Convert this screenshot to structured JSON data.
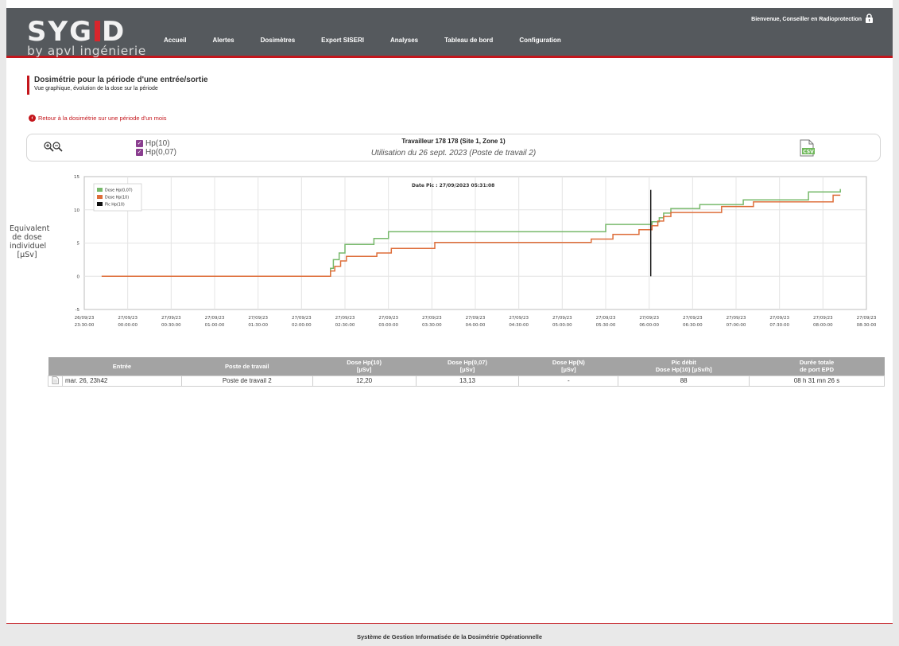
{
  "logo": {
    "main_left": "SYG",
    "main_right": "D",
    "sub": "by apvl ingénierie"
  },
  "nav": [
    "Accueil",
    "Alertes",
    "Dosimètres",
    "Export SISERI",
    "Analyses",
    "Tableau de bord",
    "Configuration"
  ],
  "welcome": "Bienvenue, Conseiller en Radioprotection",
  "page": {
    "title": "Dosimétrie pour la période d'une entrée/sortie",
    "subtitle": "Vue graphique, évolution de la dose sur la période",
    "back_link": "Retour à la dosimétrie sur une période d'un mois"
  },
  "info": {
    "checks": [
      "Hp(10)",
      "Hp(0,07)"
    ],
    "worker": "Travailleur 178 178 (Site 1, Zone 1)",
    "usage": "Utilisation du 26 sept. 2023 (Poste de travail 2)",
    "csv_label": "CSV"
  },
  "chart_data": {
    "type": "line",
    "ylabel": [
      "Equivalent",
      "de dose",
      "individuel",
      "[µSv]"
    ],
    "ylim": [
      -5,
      15
    ],
    "yticks": [
      -5,
      0,
      5,
      10,
      15
    ],
    "xlim_minutes": [
      -30,
      510
    ],
    "xticks": [
      [
        "26/09/23",
        "23:30:00"
      ],
      [
        "27/09/23",
        "00:00:00"
      ],
      [
        "27/09/23",
        "00:30:00"
      ],
      [
        "27/09/23",
        "01:00:00"
      ],
      [
        "27/09/23",
        "01:30:00"
      ],
      [
        "27/09/23",
        "02:00:00"
      ],
      [
        "27/09/23",
        "02:30:00"
      ],
      [
        "27/09/23",
        "03:00:00"
      ],
      [
        "27/09/23",
        "03:30:00"
      ],
      [
        "27/09/23",
        "04:00:00"
      ],
      [
        "27/09/23",
        "04:30:00"
      ],
      [
        "27/09/23",
        "05:00:00"
      ],
      [
        "27/09/23",
        "05:30:00"
      ],
      [
        "27/09/23",
        "06:00:00"
      ],
      [
        "27/09/23",
        "06:30:00"
      ],
      [
        "27/09/23",
        "07:00:00"
      ],
      [
        "27/09/23",
        "07:30:00"
      ],
      [
        "27/09/23",
        "08:00:00"
      ],
      [
        "27/09/23",
        "08:30:00"
      ]
    ],
    "annotation": "Date Pic : 27/09/2023 05:31:08",
    "legend": [
      "Dose Hp(0,07)",
      "Dose Hp(10)",
      "Pic Hp(10)"
    ],
    "legend_position": "top-left",
    "grid": true,
    "series": [
      {
        "name": "Dose Hp(0,07)",
        "color": "#77b96b",
        "x": [
          -18,
          140,
          140,
          142,
          142,
          146,
          146,
          150,
          150,
          170,
          170,
          180,
          180,
          330,
          330,
          362,
          362,
          367,
          367,
          370,
          370,
          375,
          375,
          395,
          395,
          425,
          425,
          470,
          470,
          492,
          492
        ],
        "y": [
          0,
          0,
          1.2,
          1.2,
          2.5,
          2.5,
          3.5,
          3.5,
          4.8,
          4.8,
          5.7,
          5.7,
          6.7,
          6.7,
          7.8,
          7.8,
          8.2,
          8.2,
          8.8,
          8.8,
          9.5,
          9.5,
          10.2,
          10.2,
          10.8,
          10.8,
          11.5,
          11.5,
          12.7,
          12.7,
          13.13
        ]
      },
      {
        "name": "Dose Hp(10)",
        "color": "#de6e3a",
        "x": [
          -18,
          140,
          140,
          143,
          143,
          147,
          147,
          151,
          151,
          172,
          172,
          182,
          182,
          212,
          212,
          320,
          320,
          335,
          335,
          353,
          353,
          362,
          362,
          366,
          366,
          370,
          370,
          375,
          375,
          410,
          410,
          432,
          432,
          487,
          487,
          492
        ],
        "y": [
          0,
          0,
          0.8,
          0.8,
          1.5,
          1.5,
          2.3,
          2.3,
          3.0,
          3.0,
          3.5,
          3.5,
          4.2,
          4.2,
          5.1,
          5.1,
          5.6,
          5.6,
          6.3,
          6.3,
          7.0,
          7.0,
          7.6,
          7.6,
          8.3,
          8.3,
          9.0,
          9.0,
          9.6,
          9.6,
          10.5,
          10.5,
          11.2,
          11.2,
          12.2,
          12.2
        ]
      },
      {
        "name": "Pic Hp(10)",
        "color": "#111111",
        "x": [
          361.1,
          361.1
        ],
        "y": [
          0,
          13
        ]
      }
    ]
  },
  "table": {
    "headers": [
      "",
      "Entrée",
      "Poste de travail",
      "Dose Hp(10)\n[µSv]",
      "Dose Hp(0,07)\n[µSv]",
      "Dose Hp(N)\n[µSv]",
      "Pic débit\nDose Hp(10) [µSv/h]",
      "Durée totale\nde port EPD"
    ],
    "rows": [
      [
        "",
        "mar. 26, 23h42",
        "Poste de travail 2",
        "12,20",
        "13,13",
        "-",
        "88",
        "08 h 31 mn 26 s"
      ]
    ]
  },
  "footer": "Système de Gestion Informatisée de la Dosimétrie Opérationnelle"
}
